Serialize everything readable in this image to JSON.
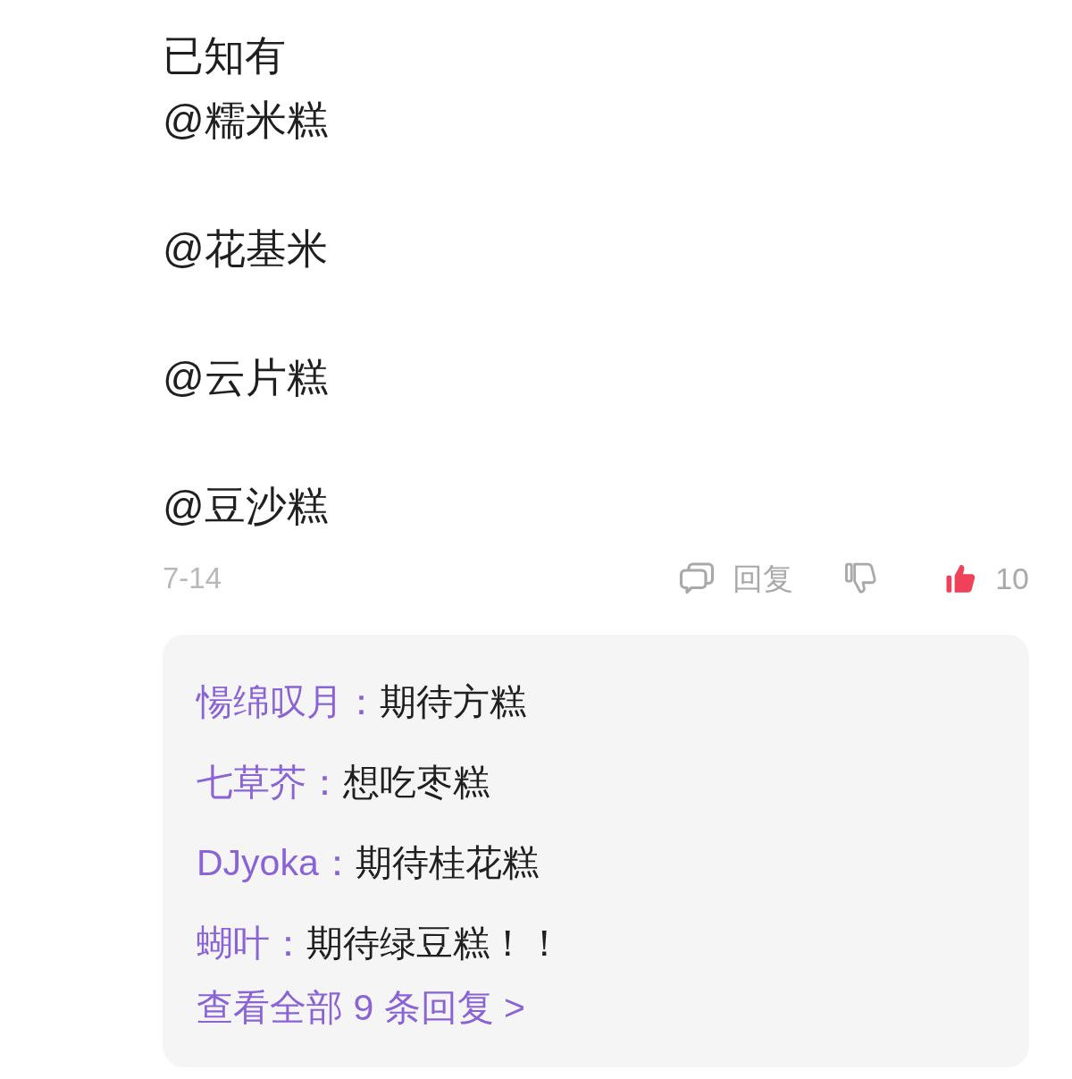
{
  "comment": {
    "paragraphs": [
      "已知有\n@糯米糕",
      "@花基米",
      "@云片糕",
      "@豆沙糕"
    ],
    "date": "7-14",
    "reply_button": {
      "label": "回复"
    },
    "dislike": {
      "on": false
    },
    "like": {
      "on": true,
      "count": "10"
    }
  },
  "replies": {
    "items": [
      {
        "name": "愓绵叹月：",
        "text": "期待方糕"
      },
      {
        "name": "七草芥：",
        "text": "想吃枣糕"
      },
      {
        "name": "DJyoka：",
        "text": "期待桂花糕"
      },
      {
        "name": "蝴叶：",
        "text": "期待绿豆糕！！"
      }
    ],
    "view_all": "查看全部 9 条回复 >"
  }
}
